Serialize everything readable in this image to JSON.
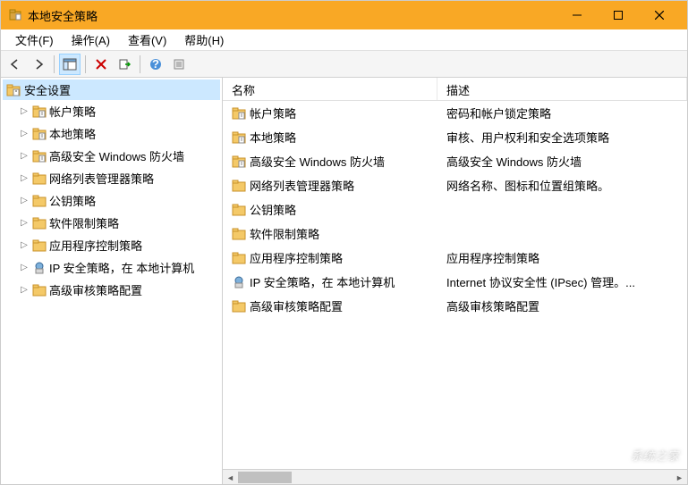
{
  "window": {
    "title": "本地安全策略"
  },
  "menu": {
    "file": "文件(F)",
    "action": "操作(A)",
    "view": "查看(V)",
    "help": "帮助(H)"
  },
  "tree": {
    "root": "安全设置",
    "items": [
      {
        "label": "帐户策略",
        "icon": "folder"
      },
      {
        "label": "本地策略",
        "icon": "folder"
      },
      {
        "label": "高级安全 Windows 防火墙",
        "icon": "folder"
      },
      {
        "label": "网络列表管理器策略",
        "icon": "folder-plain"
      },
      {
        "label": "公钥策略",
        "icon": "folder-plain"
      },
      {
        "label": "软件限制策略",
        "icon": "folder-plain"
      },
      {
        "label": "应用程序控制策略",
        "icon": "folder-plain"
      },
      {
        "label": "IP 安全策略，在 本地计算机",
        "icon": "ipsec"
      },
      {
        "label": "高级审核策略配置",
        "icon": "folder-plain"
      }
    ]
  },
  "list": {
    "columns": {
      "name": "名称",
      "desc": "描述"
    },
    "rows": [
      {
        "name": "帐户策略",
        "desc": "密码和帐户锁定策略",
        "icon": "folder"
      },
      {
        "name": "本地策略",
        "desc": "审核、用户权利和安全选项策略",
        "icon": "folder"
      },
      {
        "name": "高级安全 Windows 防火墙",
        "desc": "高级安全 Windows 防火墙",
        "icon": "folder"
      },
      {
        "name": "网络列表管理器策略",
        "desc": "网络名称、图标和位置组策略。",
        "icon": "folder-plain"
      },
      {
        "name": "公钥策略",
        "desc": "",
        "icon": "folder-plain"
      },
      {
        "name": "软件限制策略",
        "desc": "",
        "icon": "folder-plain"
      },
      {
        "name": "应用程序控制策略",
        "desc": "应用程序控制策略",
        "icon": "folder-plain"
      },
      {
        "name": "IP 安全策略，在 本地计算机",
        "desc": "Internet 协议安全性 (IPsec) 管理。...",
        "icon": "ipsec"
      },
      {
        "name": "高级审核策略配置",
        "desc": "高级审核策略配置",
        "icon": "folder-plain"
      }
    ]
  },
  "watermark": "系统之家"
}
